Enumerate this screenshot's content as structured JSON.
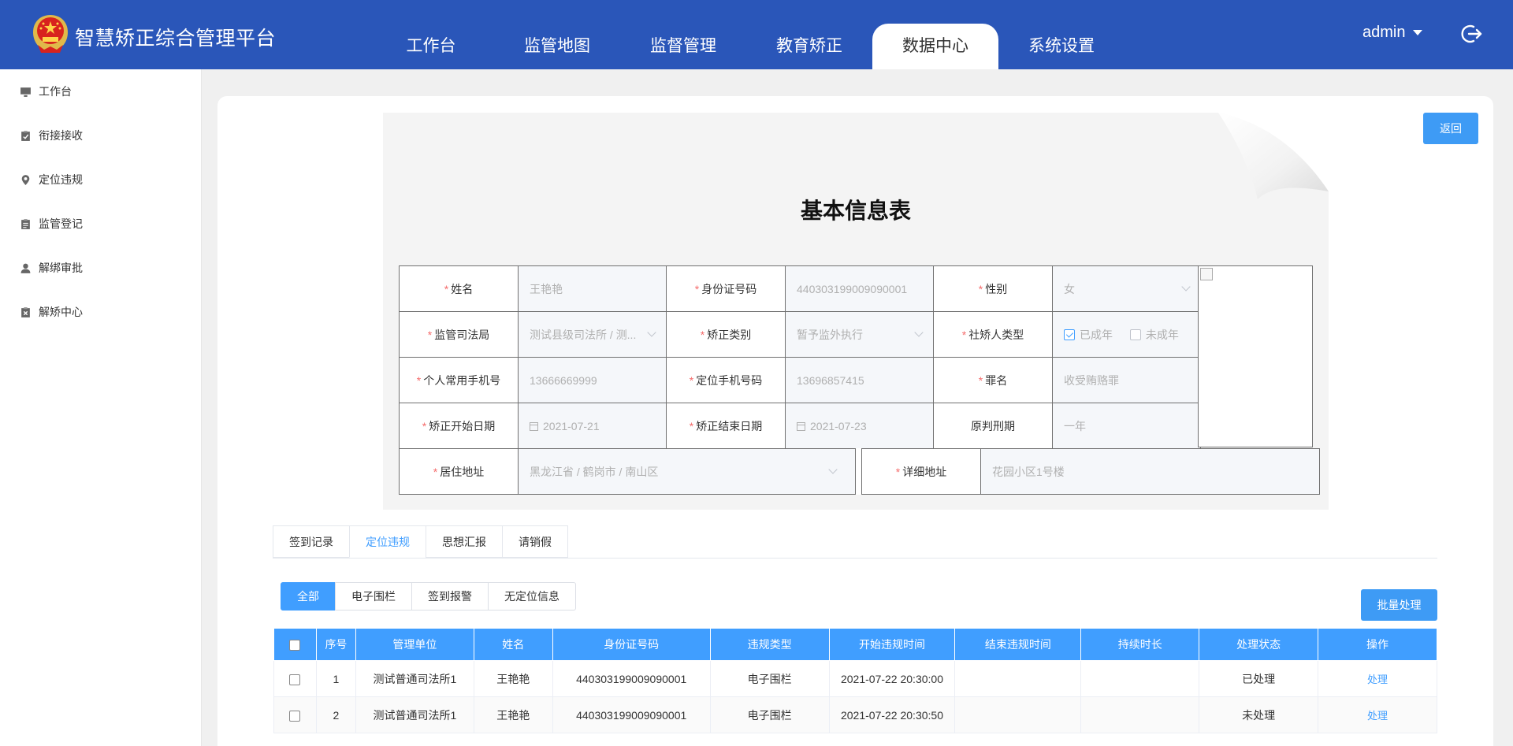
{
  "app": {
    "title": "智慧矫正综合管理平台"
  },
  "nav": [
    "工作台",
    "监管地图",
    "监督管理",
    "教育矫正",
    "数据中心",
    "系统设置"
  ],
  "nav_active": 4,
  "user": {
    "name": "admin"
  },
  "sidebar": [
    {
      "label": "工作台",
      "icon": "monitor-icon"
    },
    {
      "label": "衔接接收",
      "icon": "clipboard-check-icon"
    },
    {
      "label": "定位违规",
      "icon": "location-pin-icon"
    },
    {
      "label": "监管登记",
      "icon": "clipboard-list-icon"
    },
    {
      "label": "解绑审批",
      "icon": "user-icon"
    },
    {
      "label": "解矫中心",
      "icon": "clipboard-x-icon"
    }
  ],
  "back_label": "返回",
  "sheet": {
    "title": "基本信息表",
    "name_label": "姓名",
    "name_value": "王艳艳",
    "id_label": "身份证号码",
    "id_value": "440303199009090001",
    "gender_label": "性别",
    "gender_value": "女",
    "bureau_label": "监管司法局",
    "bureau_value": "测试县级司法所 / 测...",
    "type_label": "矫正类别",
    "type_value": "暂予监外执行",
    "person_type_label": "社矫人类型",
    "adult_label": "已成年",
    "minor_label": "未成年",
    "phone_label": "个人常用手机号",
    "phone_value": "13666669999",
    "loc_phone_label": "定位手机号码",
    "loc_phone_value": "13696857415",
    "crime_label": "罪名",
    "crime_value": "收受贿赂罪",
    "start_label": "矫正开始日期",
    "start_value": "2021-07-21",
    "end_label": "矫正结束日期",
    "end_value": "2021-07-23",
    "sentence_label": "原判刑期",
    "sentence_value": "一年",
    "addr_label": "居住地址",
    "addr_value": "黑龙江省 / 鹤岗市 / 南山区",
    "detail_label": "详细地址",
    "detail_value": "花园小区1号楼"
  },
  "tabs": [
    "签到记录",
    "定位违规",
    "思想汇报",
    "请销假"
  ],
  "tab_active": 1,
  "filters": [
    "全部",
    "电子围栏",
    "签到报警",
    "无定位信息"
  ],
  "filter_active": 0,
  "batch_label": "批量处理",
  "table": {
    "columns": [
      "序号",
      "管理单位",
      "姓名",
      "身份证号码",
      "违规类型",
      "开始违规时间",
      "结束违规时间",
      "持续时长",
      "处理状态",
      "操作"
    ],
    "rows": [
      [
        "1",
        "测试普通司法所1",
        "王艳艳",
        "440303199009090001",
        "电子围栏",
        "2021-07-22 20:30:00",
        "",
        "",
        "已处理",
        "处理"
      ],
      [
        "2",
        "测试普通司法所1",
        "王艳艳",
        "440303199009090001",
        "电子围栏",
        "2021-07-22 20:30:50",
        "",
        "",
        "未处理",
        "处理"
      ]
    ]
  }
}
